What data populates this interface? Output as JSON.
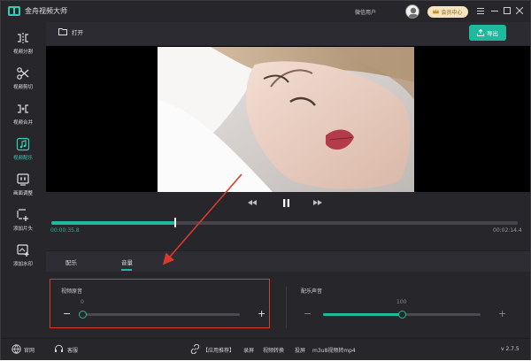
{
  "app": {
    "title": "金舟视频大师"
  },
  "titlebar": {
    "user_name": "微信用户",
    "vip_label": "会员中心"
  },
  "toolbar": {
    "open_label": "打开",
    "export_label": "导出"
  },
  "sidebar": {
    "items": [
      {
        "label": "视频分割",
        "icon": "split-icon"
      },
      {
        "label": "视频剪切",
        "icon": "scissors-icon"
      },
      {
        "label": "视频合并",
        "icon": "merge-icon"
      },
      {
        "label": "视频配乐",
        "icon": "music-note-icon",
        "active": true
      },
      {
        "label": "画面调整",
        "icon": "adjust-icon"
      },
      {
        "label": "添加片头",
        "icon": "add-intro-icon"
      },
      {
        "label": "添加水印",
        "icon": "watermark-icon"
      }
    ]
  },
  "player": {
    "current_time": "00:00:35.8",
    "total_time": "00:02:14.4",
    "progress_fraction": 0.266
  },
  "tabs": [
    {
      "label": "配乐"
    },
    {
      "label": "音量",
      "active": true
    }
  ],
  "audio": {
    "original": {
      "title": "视频原音",
      "value": "0",
      "level": 0.0
    },
    "music": {
      "title": "配乐声音",
      "value": "100",
      "level": 0.5
    }
  },
  "footer": {
    "website": "官网",
    "support": "客服",
    "recommend": "【应用推荐】",
    "links": [
      "录屏",
      "视频转换",
      "投屏",
      "m3u8视频转mp4"
    ],
    "version": "v 2.7.5"
  },
  "colors": {
    "accent": "#1fb99e",
    "annotation": "#d93a2b"
  }
}
